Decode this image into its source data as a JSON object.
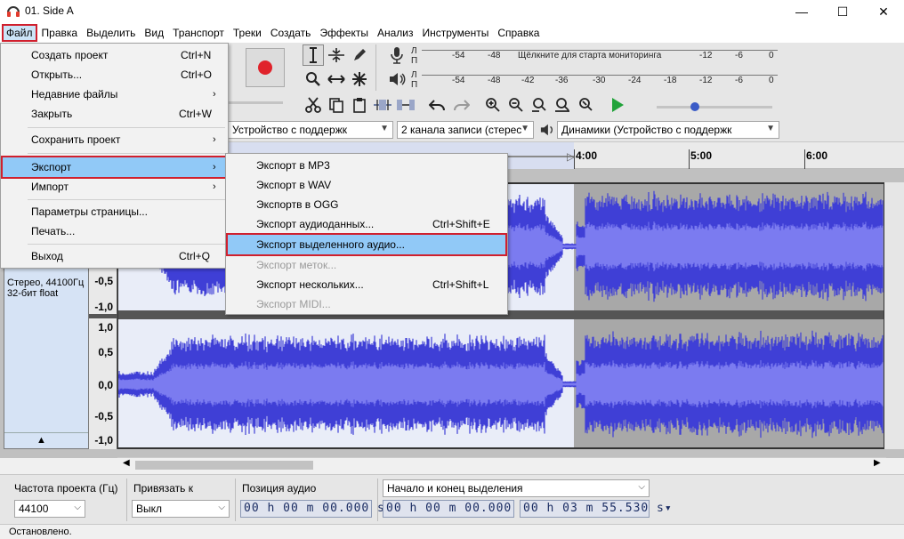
{
  "window": {
    "title": "01. Side A",
    "icon": "headphones-icon",
    "controls": {
      "minimize": "—",
      "maximize": "☐",
      "close": "✕"
    }
  },
  "menubar": [
    "Файл",
    "Правка",
    "Выделить",
    "Вид",
    "Транспорт",
    "Треки",
    "Создать",
    "Эффекты",
    "Анализ",
    "Инструменты",
    "Справка"
  ],
  "file_menu": [
    {
      "label": "Создать проект",
      "shortcut": "Ctrl+N"
    },
    {
      "label": "Открыть...",
      "shortcut": "Ctrl+O"
    },
    {
      "label": "Недавние файлы",
      "submenu": true
    },
    {
      "label": "Закрыть",
      "shortcut": "Ctrl+W"
    },
    {
      "label": "Сохранить проект",
      "submenu": true
    },
    {
      "label": "Экспорт",
      "submenu": true
    },
    {
      "label": "Импорт",
      "submenu": true
    },
    {
      "label": "Параметры страницы..."
    },
    {
      "label": "Печать..."
    },
    {
      "label": "Выход",
      "shortcut": "Ctrl+Q"
    }
  ],
  "export_submenu": [
    {
      "label": "Экспорт в MP3"
    },
    {
      "label": "Экспорт в WAV"
    },
    {
      "label": "Экспортв в OGG"
    },
    {
      "label": "Экспорт аудиоданных...",
      "shortcut": "Ctrl+Shift+E"
    },
    {
      "label": "Экспорт выделенного аудио..."
    },
    {
      "label": "Экспорт меток...",
      "disabled": true
    },
    {
      "label": "Экспорт нескольких...",
      "shortcut": "Ctrl+Shift+L"
    },
    {
      "label": "Экспорт MIDI...",
      "disabled": true
    }
  ],
  "meters": {
    "record_scale": [
      "-54",
      "-48",
      "Щёлкните для старта мониторинга",
      "-12",
      "-6",
      "0"
    ],
    "play_scale": [
      "-54",
      "-48",
      "-42",
      "-36",
      "-30",
      "-24",
      "-18",
      "-12",
      "-6",
      "0"
    ],
    "channel_labels": [
      "Л",
      "П"
    ]
  },
  "devices": {
    "input": "Устройство с поддержк",
    "channels": "2 канала записи (стерес",
    "output": "Динамики (Устройство с поддержк"
  },
  "ruler": [
    "4:00",
    "5:00",
    "6:00"
  ],
  "track": {
    "info_line1": "Стерео, 44100Гц",
    "info_line2": "32-бит float",
    "scale_top": [
      "-0,5",
      "-1,0"
    ],
    "scale_bottom": [
      "1,0",
      "0,5",
      "0,0",
      "-0,5",
      "-1,0"
    ],
    "collapse": "▲"
  },
  "selection_toolbar": {
    "rate_label": "Частота проекта (Гц)",
    "rate_value": "44100",
    "snap_label": "Привязать к",
    "snap_value": "Выкл",
    "pos_label": "Позиция аудио",
    "pos_value": "00 h 00 m 00.000 s",
    "range_label": "Начало и конец выделения",
    "start_value": "00 h 00 m 00.000 s",
    "end_value": "00 h 03 m 55.530 s"
  },
  "status": "Остановлено.",
  "colors": {
    "wave": "#3f3fd6",
    "wave_light": "#7b7bf0",
    "selection_bg": "#e9edf8",
    "unselected_bg": "#a8a8a8",
    "highlight_box": "#d0202e",
    "menu_hover": "#91c9f7"
  }
}
